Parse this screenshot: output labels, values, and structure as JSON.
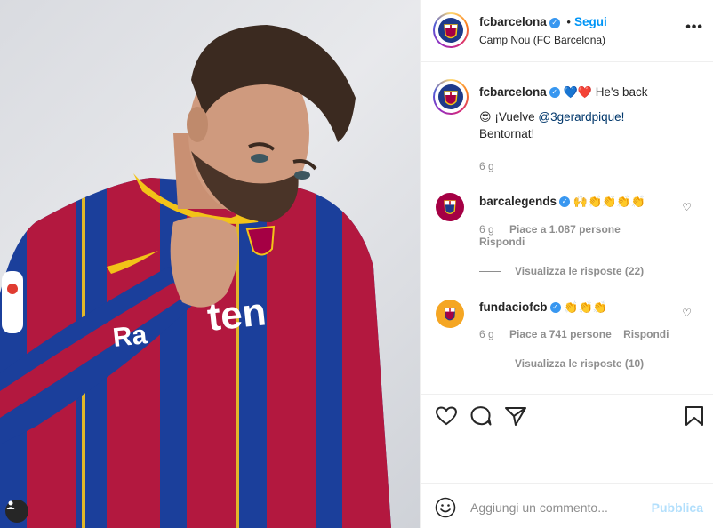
{
  "header": {
    "username": "fcbarcelona",
    "follow_label": "Segui",
    "separator": "•",
    "location": "Camp Nou (FC Barcelona)",
    "more_icon": "more-horizontal-icon"
  },
  "caption": {
    "username": "fcbarcelona",
    "hearts": "💙❤️",
    "text": "He's back",
    "line2_emoji": "😍",
    "line2_prefix": "¡Vuelve ",
    "mention": "@3gerardpique!",
    "line3": "Bentornat!",
    "time": "6 g"
  },
  "comments": [
    {
      "username": "barcalegends",
      "text": "🙌👏👏👏👏",
      "time": "6 g",
      "likes": "Piace a 1.087 persone",
      "reply": "Rispondi",
      "view_replies": "Visualizza le risposte (22)"
    },
    {
      "username": "fundaciofcb",
      "text": "👏👏👏",
      "time": "6 g",
      "likes": "Piace a 741 persone",
      "reply": "Rispondi",
      "view_replies": "Visualizza le risposte (10)"
    }
  ],
  "add_comment": {
    "placeholder": "Aggiungi un commento...",
    "publish_label": "Pubblica"
  },
  "colors": {
    "accent_blue": "#0095f6",
    "verified": "#3897f0",
    "barca_blue": "#1e3a8a",
    "barca_red": "#a50044"
  }
}
